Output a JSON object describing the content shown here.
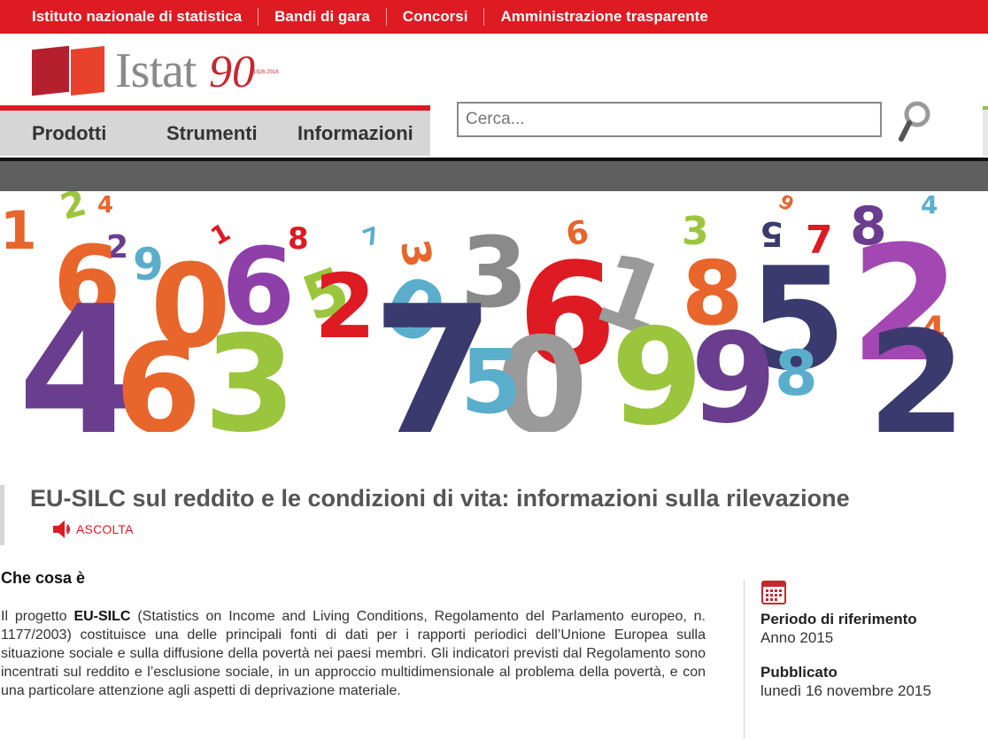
{
  "topbar": {
    "links": [
      "Istituto nazionale di statistica",
      "Bandi di gara",
      "Concorsi",
      "Amministrazione trasparente"
    ]
  },
  "logo": {
    "text": "Istat",
    "anniversary": "90",
    "years": "1926-2016"
  },
  "nav": {
    "items": [
      "Prodotti",
      "Strumenti",
      "Informazioni"
    ]
  },
  "search": {
    "placeholder": "Cerca..."
  },
  "page": {
    "title": "EU-SILC sul reddito e le condizioni di vita: informazioni sulla rilevazione",
    "listen_label": "ASCOLTA"
  },
  "content": {
    "heading": "Che cosa è",
    "body_prefix": "Il progetto ",
    "body_bold": "EU-SILC",
    "body_rest": " (Statistics on Income and Living Conditions, Regolamento del Parlamento europeo, n. 1177/2003) costituisce una delle principali fonti di dati per i rapporti periodici dell’Unione Europea sulla situazione sociale e sulla diffusione della povertà nei paesi membri. Gli indicatori previsti dal Regolamento sono incentrati sul reddito e l’esclusione sociale, in un approccio multidimensionale al problema della povertà, e con una particolare attenzione agli aspetti di deprivazione materiale."
  },
  "sidebar": {
    "period_label": "Periodo di riferimento",
    "period_value": "Anno 2015",
    "published_label": "Pubblicato",
    "published_value": "lunedì 16 novembre 2015"
  },
  "colors": {
    "brand_red": "#de1a22",
    "nav_grey": "#d6d6d6",
    "dark_bar": "#5f5f5f"
  },
  "banner": {
    "digits": [
      "1",
      "2",
      "4",
      "2",
      "6",
      "9",
      "0",
      "6",
      "1",
      "8",
      "7",
      "3",
      "5",
      "2",
      "0",
      "3",
      "6",
      "1",
      "8",
      "3",
      "5",
      "7",
      "9",
      "8",
      "4",
      "5",
      "4",
      "6",
      "9",
      "2",
      "8",
      "3",
      "0",
      "5",
      "7",
      "4",
      "9",
      "6",
      "2"
    ]
  }
}
